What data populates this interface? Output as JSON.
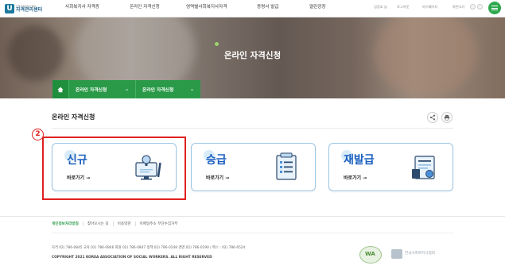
{
  "header": {
    "logo_sub": "한국사회복지사협회",
    "logo_main": "자격관리센터",
    "nav": [
      "사회복지사 자격증",
      "온라인 자격신청",
      "영역별사회복지사자격",
      "증명서 발급",
      "열린광장"
    ],
    "util": [
      "업정호 님",
      "로그아웃",
      "마이페이지",
      "화면크기"
    ],
    "util_controls": [
      "minus-icon",
      "plus-icon"
    ],
    "menu_icon": "hamburger-icon"
  },
  "hero": {
    "title": "온라인 자격신청",
    "breadcrumb": [
      "온라인 자격신청",
      "온라인 자격신청"
    ],
    "home_icon": "home-icon"
  },
  "main": {
    "title": "온라인 자격신청",
    "tools": [
      "share-icon",
      "print-icon"
    ],
    "step_badge": "2",
    "cards": [
      {
        "title": "신규",
        "link": "바로가기 →",
        "icon": "computer-lightbulb-icon"
      },
      {
        "title": "승급",
        "link": "바로가기 →",
        "icon": "document-list-icon"
      },
      {
        "title": "재발급",
        "link": "바로가기 →",
        "icon": "certificate-icon"
      }
    ]
  },
  "footer": {
    "links": [
      "개인정보처리방침",
      "찾아오시는 길",
      "이용약관",
      "이메일주소 무단수집거부"
    ],
    "contact": "자격 02) 786-0845 교육 02) 786-0846 회원 02) 786-0847 정책 02) 786-0248 경영 02) 786-0190   /   팩스 : 02) 786-6524",
    "copyright": "COPYRIGHT 2021 KOREA ASSOCIATION OF SOCIAL WORKERS. ALL RIGHT RESERVED",
    "wa_mark": "WA",
    "footer_logo_text": "한국사회복지사협회"
  },
  "colors": {
    "green": "#2a9a48",
    "blue": "#1a5fbf",
    "highlight": "#e02020"
  }
}
